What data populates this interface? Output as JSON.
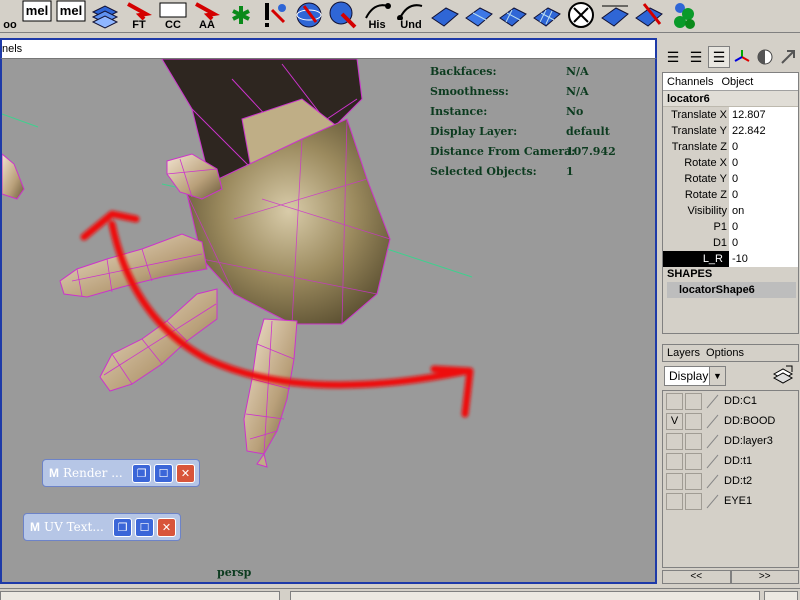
{
  "shelf": {
    "buttons": [
      {
        "name": "shelf-loo",
        "label": "oo"
      },
      {
        "name": "shelf-mel-1",
        "label": "mel"
      },
      {
        "name": "shelf-mel-2",
        "label": "mel"
      },
      {
        "name": "shelf-layers",
        "label": ""
      },
      {
        "name": "shelf-ft",
        "label": "FT"
      },
      {
        "name": "shelf-cc",
        "label": "CC"
      },
      {
        "name": "shelf-aa",
        "label": "AA"
      },
      {
        "name": "shelf-asterisk",
        "label": ""
      },
      {
        "name": "shelf-bang",
        "label": ""
      },
      {
        "name": "shelf-globe",
        "label": ""
      },
      {
        "name": "shelf-globe-red",
        "label": ""
      },
      {
        "name": "shelf-his",
        "label": "His"
      },
      {
        "name": "shelf-und",
        "label": "Und"
      },
      {
        "name": "shelf-plane-1",
        "label": ""
      },
      {
        "name": "shelf-plane-2",
        "label": ""
      },
      {
        "name": "shelf-plane-3",
        "label": ""
      },
      {
        "name": "shelf-plane-4",
        "label": ""
      },
      {
        "name": "shelf-circle-x",
        "label": ""
      },
      {
        "name": "shelf-plane-5",
        "label": ""
      },
      {
        "name": "shelf-plane-6",
        "label": ""
      },
      {
        "name": "shelf-spheres",
        "label": ""
      }
    ]
  },
  "viewport": {
    "panel_title": "nels",
    "camera": "persp",
    "hud": [
      {
        "label": "Backfaces:",
        "value": "N/A"
      },
      {
        "label": "Smoothness:",
        "value": "N/A"
      },
      {
        "label": "Instance:",
        "value": "No"
      },
      {
        "label": "Display Layer:",
        "value": "default"
      },
      {
        "label": "Distance From Camera:",
        "value": "107.942"
      },
      {
        "label": "Selected Objects:",
        "value": "1"
      }
    ],
    "mini_windows": [
      {
        "title": "Render ..."
      },
      {
        "title": "UV Text..."
      }
    ]
  },
  "channel_box": {
    "menu": [
      "Channels",
      "Object"
    ],
    "object": "locator6",
    "channels": [
      {
        "name": "Translate X",
        "value": "12.807"
      },
      {
        "name": "Translate Y",
        "value": "22.842"
      },
      {
        "name": "Translate Z",
        "value": "0"
      },
      {
        "name": "Rotate X",
        "value": "0"
      },
      {
        "name": "Rotate Y",
        "value": "0"
      },
      {
        "name": "Rotate Z",
        "value": "0"
      },
      {
        "name": "Visibility",
        "value": "on"
      },
      {
        "name": "P1",
        "value": "0"
      },
      {
        "name": "D1",
        "value": "0"
      },
      {
        "name": "L_R",
        "value": "-10"
      }
    ],
    "shapes_header": "SHAPES",
    "shape": "locatorShape6"
  },
  "layers": {
    "menu": [
      "Layers",
      "Options"
    ],
    "display_mode": "Display",
    "items": [
      {
        "vis": "",
        "name": "DD:C1"
      },
      {
        "vis": "V",
        "name": "DD:BOOD"
      },
      {
        "vis": "",
        "name": "DD:layer3"
      },
      {
        "vis": "",
        "name": "DD:t1"
      },
      {
        "vis": "",
        "name": "DD:t2"
      },
      {
        "vis": "",
        "name": "EYE1"
      }
    ],
    "scroll_left": "<<",
    "scroll_right": ">>"
  },
  "colors": {
    "viewport_bg": "#9a9a9a",
    "panel_border": "#1e3aa8",
    "hud_text": "#0c3b1f",
    "wire": "#cc33cc",
    "red_arrow": "#ee1111"
  }
}
